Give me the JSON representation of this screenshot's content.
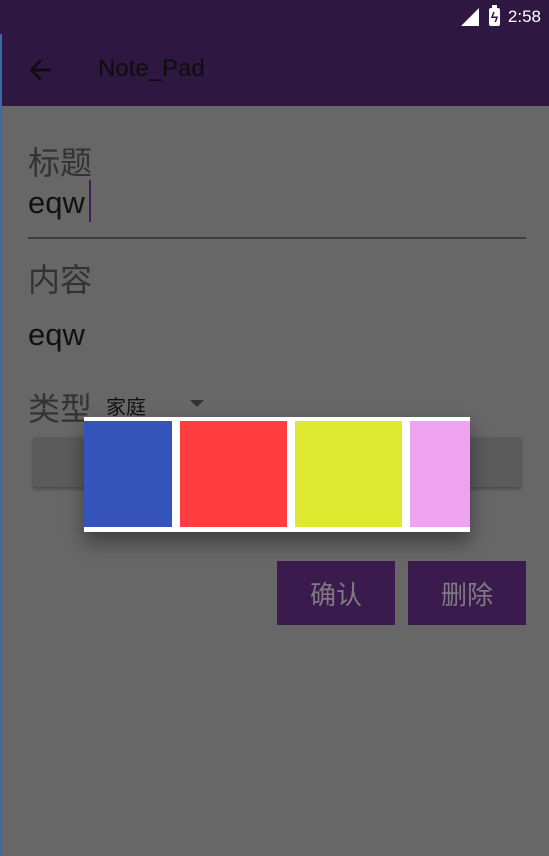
{
  "status_bar": {
    "time": "2:58"
  },
  "app_bar": {
    "title": "Note_Pad"
  },
  "form": {
    "title_label": "标题",
    "title_value": "eqw",
    "content_label": "内容",
    "content_value": "eqw",
    "type_label": "类型",
    "type_value": "家庭"
  },
  "color_picker": {
    "colors": [
      "#3454bc",
      "#ff3d3e",
      "#dfe830",
      "#efa2ef"
    ]
  },
  "actions": {
    "confirm_label": "确认",
    "delete_label": "删除"
  }
}
